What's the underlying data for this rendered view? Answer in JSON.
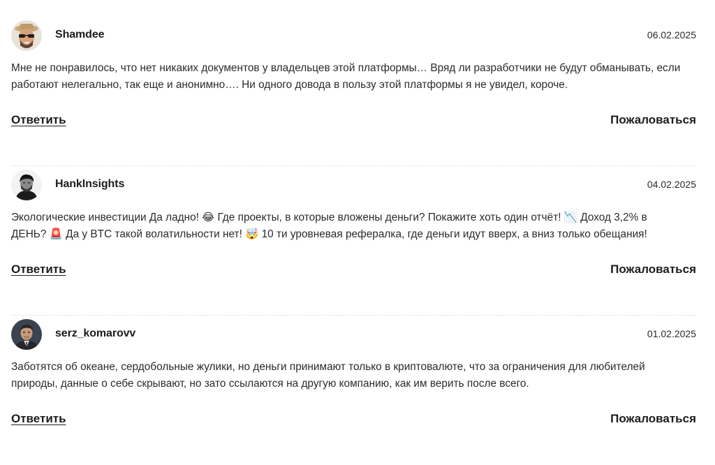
{
  "reviews": [
    {
      "author": "Shamdee",
      "date": "06.02.2025",
      "text": "Мне не понравилось, что нет никаких документов у владельцев этой платформы… Вряд ли разработчики не будут обманывать, если\nработают нелегально, так еще и анонимно…. Ни одного довода в пользу этой платформы я не увидел, короче.",
      "reply_label": "Ответить",
      "complain_label": "Пожаловаться",
      "avatar_icon": "avatar-man-sunglasses-hat"
    },
    {
      "author": "HankInsights",
      "date": "04.02.2025",
      "text": "Экологические инвестиции Да ладно! 😂 Где проекты, в которые вложены деньги? Покажите хоть один отчёт! 📉 Доход 3,2% в\nДЕНЬ? 🚨 Да у BTC такой волатильности нет! 🤯 10 ти уровневая рефералка, где деньги идут вверх, а вниз только обещания!",
      "reply_label": "Ответить",
      "complain_label": "Пожаловаться",
      "avatar_icon": "avatar-man-bw-portrait"
    },
    {
      "author": "serz_komarovv",
      "date": "01.02.2025",
      "text": "Заботятся об океане, сердобольные жулики, но деньги принимают только в криптовалюте, что за ограничения для любителей\nприроды, данные о себе скрывают, но зато ссылаются на другую компанию, как им верить после всего.",
      "reply_label": "Ответить",
      "complain_label": "Пожаловаться",
      "avatar_icon": "avatar-man-suit"
    }
  ]
}
